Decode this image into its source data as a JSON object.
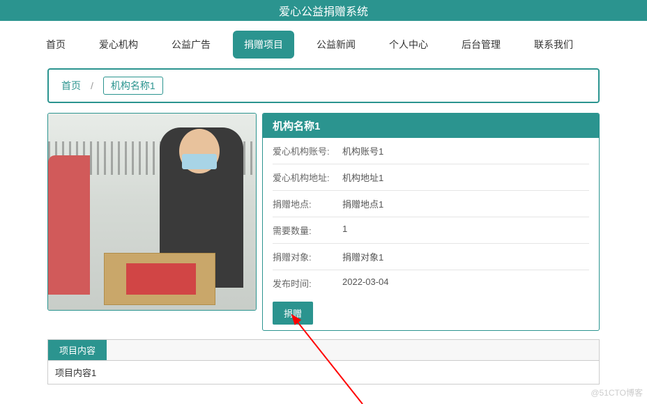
{
  "header": {
    "title": "爱心公益捐赠系统"
  },
  "nav": {
    "items": [
      "首页",
      "爱心机构",
      "公益广告",
      "捐赠项目",
      "公益新闻",
      "个人中心",
      "后台管理",
      "联系我们"
    ],
    "activeIndex": 3
  },
  "breadcrumb": {
    "home": "首页",
    "current": "机构名称1"
  },
  "detail": {
    "title": "机构名称1",
    "rows": [
      {
        "label": "爱心机构账号:",
        "value": "机构账号1"
      },
      {
        "label": "爱心机构地址:",
        "value": "机构地址1"
      },
      {
        "label": "捐赠地点:",
        "value": "捐赠地点1"
      },
      {
        "label": "需要数量:",
        "value": "1"
      },
      {
        "label": "捐赠对象:",
        "value": "捐赠对象1"
      },
      {
        "label": "发布时间:",
        "value": "2022-03-04"
      }
    ],
    "donateLabel": "捐赠"
  },
  "tabs": {
    "title": "项目内容",
    "body": "项目内容1"
  },
  "watermark": "@51CTO博客"
}
